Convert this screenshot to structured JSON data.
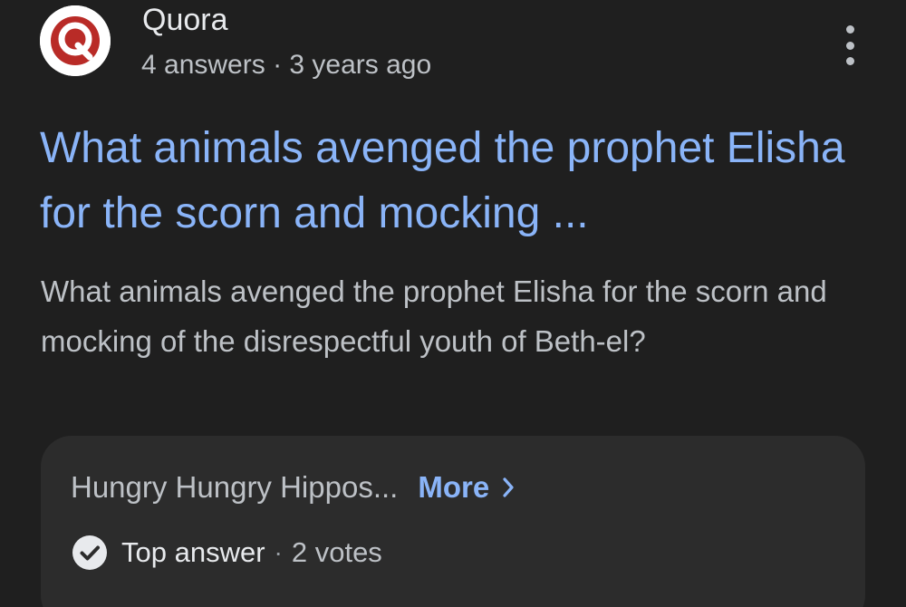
{
  "source": {
    "logo_icon": "quora-logo-icon",
    "name": "Quora",
    "meta": "4 answers · 3 years ago"
  },
  "menu_icon": "more-vert-icon",
  "result": {
    "title": "What animals avenged the prophet Elisha for the scorn and mocking ...",
    "snippet": "What animals avenged the prophet Elisha for the scorn and mocking of the disrespectful youth of Beth-el?"
  },
  "answer": {
    "preview": "Hungry Hungry Hippos...",
    "more_label": "More",
    "more_icon": "chevron-right-icon",
    "badge_icon": "check-circle-icon",
    "top_answer_label": "Top answer",
    "separator": "·",
    "votes": "2 votes"
  },
  "colors": {
    "background": "#1f1f1f",
    "link": "#8ab4f8",
    "answer_box": "#2c2c2c",
    "quora_red": "#b92b27"
  }
}
